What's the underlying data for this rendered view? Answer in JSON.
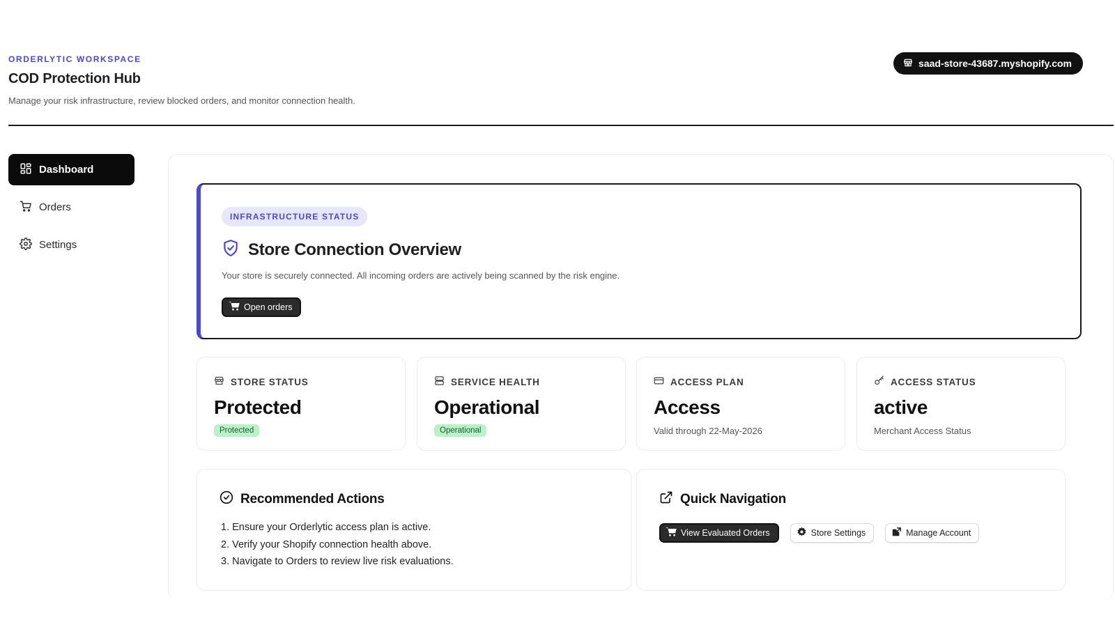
{
  "header": {
    "eyebrow": "ORDERLYTIC WORKSPACE",
    "title": "COD Protection Hub",
    "subtitle": "Manage your risk infrastructure, review blocked orders, and monitor connection health.",
    "store_domain": "saad-store-43687.myshopify.com",
    "store_icon": "storefront-icon"
  },
  "sidebar": {
    "items": [
      {
        "label": "Dashboard",
        "icon": "grid-icon",
        "active": true
      },
      {
        "label": "Orders",
        "icon": "cart-icon",
        "active": false
      },
      {
        "label": "Settings",
        "icon": "gear-icon",
        "active": false
      }
    ]
  },
  "hero": {
    "badge": "INFRASTRUCTURE STATUS",
    "title": "Store Connection Overview",
    "description": "Your store is securely connected. All incoming orders are actively being scanned by the risk engine.",
    "button_label": "Open orders"
  },
  "stats": [
    {
      "label": "STORE STATUS",
      "icon": "storefront-icon",
      "value": "Protected",
      "tag": "Protected"
    },
    {
      "label": "SERVICE HEALTH",
      "icon": "server-icon",
      "value": "Operational",
      "tag": "Operational"
    },
    {
      "label": "ACCESS PLAN",
      "icon": "credit-card-icon",
      "value": "Access",
      "sub": "Valid through 22-May-2026"
    },
    {
      "label": "ACCESS STATUS",
      "icon": "key-icon",
      "value": "active",
      "sub": "Merchant Access Status"
    }
  ],
  "recommended": {
    "title": "Recommended Actions",
    "items": [
      "1. Ensure your Orderlytic access plan is active.",
      "2. Verify your Shopify connection health above.",
      "3. Navigate to Orders to review live risk evaluations."
    ]
  },
  "quick_nav": {
    "title": "Quick Navigation",
    "buttons": [
      {
        "label": "View Evaluated Orders",
        "icon": "cart-icon"
      },
      {
        "label": "Store Settings",
        "icon": "gear-icon"
      },
      {
        "label": "Manage Account",
        "icon": "external-link-icon"
      }
    ]
  },
  "colors": {
    "accent": "#4a47d6",
    "status_green_bg": "#b9f1c9",
    "status_green_text": "#155d2b",
    "dark": "#111111"
  }
}
